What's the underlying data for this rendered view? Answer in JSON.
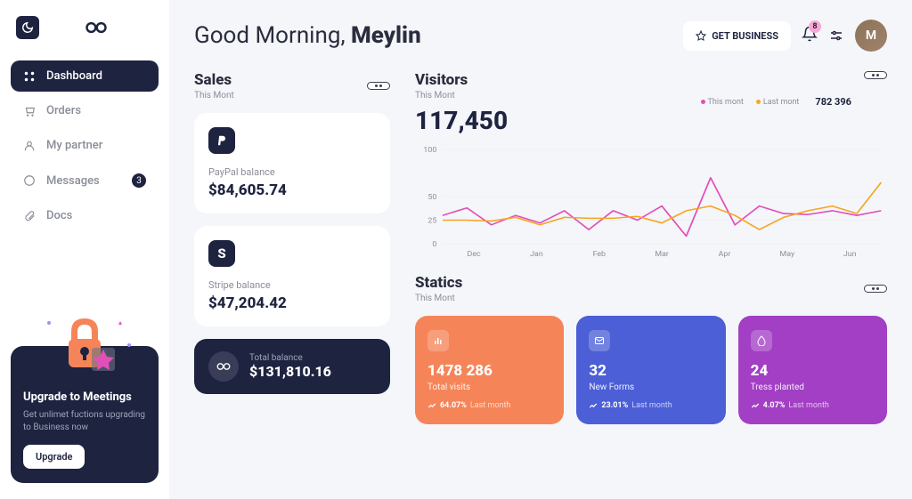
{
  "sidebar": {
    "items": [
      {
        "label": "Dashboard"
      },
      {
        "label": "Orders"
      },
      {
        "label": "My partner"
      },
      {
        "label": "Messages",
        "badge": "3"
      },
      {
        "label": "Docs"
      }
    ]
  },
  "upgrade": {
    "title": "Upgrade to Meetings",
    "desc": "Get unlimet fuctions upgrading to Business now",
    "button": "Upgrade"
  },
  "header": {
    "greeting_prefix": "Good Morning, ",
    "greeting_name": "Meylin",
    "get_business": "GET BUSINESS",
    "notif_count": "8"
  },
  "sales": {
    "title": "Sales",
    "sub": "This Mont",
    "cards": [
      {
        "label": "PayPal balance",
        "value": "$84,605.74"
      },
      {
        "label": "Stripe balance",
        "value": "$47,204.42"
      }
    ],
    "total_label": "Total balance",
    "total_value": "$131,810.16"
  },
  "visitors": {
    "title": "Visitors",
    "sub": "This Mont",
    "value": "117,450",
    "legend": [
      {
        "label": "This mont",
        "color": "#e14fb8"
      },
      {
        "label": "Last mont",
        "color": "#f5a623"
      }
    ],
    "legend_value": "782 396"
  },
  "chart_data": {
    "type": "line",
    "categories": [
      "Dec",
      "Jan",
      "Feb",
      "Mar",
      "Apr",
      "May",
      "Jun"
    ],
    "ylim": [
      0,
      100
    ],
    "yticks": [
      0,
      25,
      50,
      100
    ],
    "series": [
      {
        "name": "This mont",
        "color": "#e14fb8",
        "values": [
          30,
          38,
          20,
          30,
          22,
          35,
          15,
          35,
          25,
          40,
          8,
          70,
          20,
          40,
          32,
          31,
          35,
          30,
          35
        ]
      },
      {
        "name": "Last mont",
        "color": "#f5a623",
        "values": [
          25,
          25,
          24,
          28,
          20,
          28,
          27,
          27,
          29,
          22,
          35,
          40,
          30,
          15,
          28,
          35,
          40,
          32,
          65
        ]
      }
    ]
  },
  "statics": {
    "title": "Statics",
    "sub": "This Mont",
    "cards": [
      {
        "value": "1478 286",
        "label": "Total visits",
        "pct": "64.07%",
        "lm": "Last month"
      },
      {
        "value": "32",
        "label": "New Forms",
        "pct": "23.01%",
        "lm": "Last month"
      },
      {
        "value": "24",
        "label": "Tress planted",
        "pct": "4.07%",
        "lm": "Last month"
      }
    ]
  }
}
